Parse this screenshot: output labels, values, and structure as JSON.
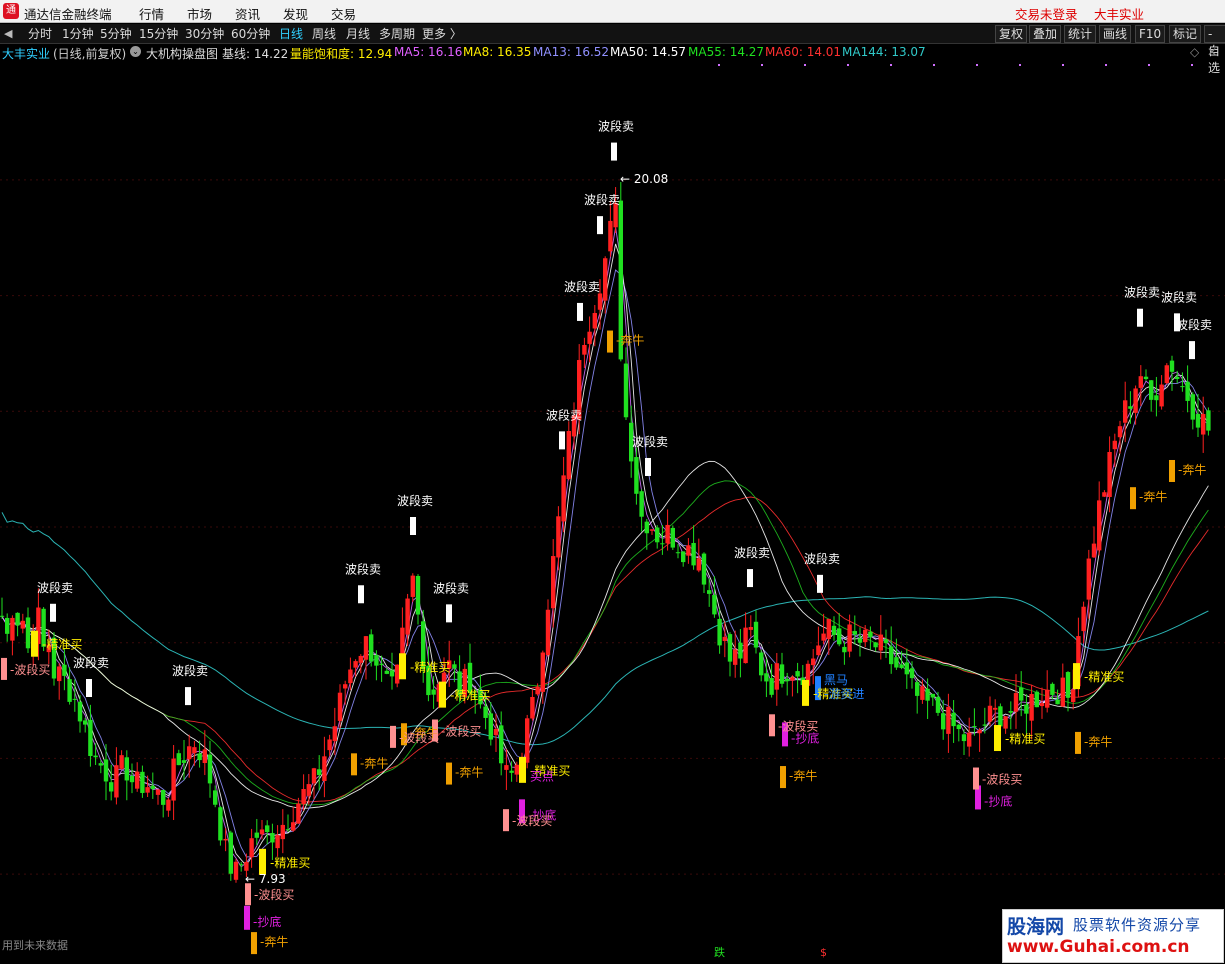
{
  "menubar": {
    "app_title": "通达信金融终端",
    "items": [
      "行情",
      "市场",
      "资讯",
      "发现",
      "交易"
    ],
    "login_status": "交易未登录",
    "stock_name": "大丰实业"
  },
  "toolbar": {
    "periods": [
      "分时",
      "1分钟",
      "5分钟",
      "15分钟",
      "30分钟",
      "60分钟",
      "日线",
      "周线",
      "月线",
      "多周期",
      "更多 〉"
    ],
    "active_period": "日线",
    "buttons": [
      "复权",
      "叠加",
      "统计",
      "画线",
      "F10",
      "标记",
      "-自选"
    ]
  },
  "infobar": {
    "stock": "大丰实业",
    "mode": "(日线,前复权)",
    "indicator_icon": "chevron-circle-icon",
    "indicator_name": "大机构操盘图",
    "baseline": "基线: 14.22",
    "energy": "量能饱和度: 12.94",
    "ma5": "MA5: 16.16",
    "ma8": "MA8: 16.35",
    "ma13": "MA13: 16.52",
    "ma50": "MA50: 14.57",
    "ma55": "MA55: 14.27",
    "ma60": "MA60: 14.01",
    "ma144": "MA144: 13.07"
  },
  "colors": {
    "up": "#ff2020",
    "down": "#20e020",
    "ma5": "#d070ff",
    "ma8": "#ffffff",
    "ma13": "#9090ff",
    "ma50": "#ffffff",
    "ma55": "#20c020",
    "ma60": "#ff3030",
    "ma144": "#30c8c8",
    "sell_box": "#ffffff",
    "buy_yellow": "#ffee00",
    "bull_orange": "#f0a000",
    "dip_magenta": "#e020e0",
    "wave_buy_pink": "#ff9090",
    "dark_horse_blue": "#2080ff"
  },
  "chart_data": {
    "type": "candlestick",
    "title": "大机构操盘图",
    "ylim": [
      7,
      21
    ],
    "high_label": "20.08",
    "low_label": "7.93",
    "signal_labels": {
      "wave_sell": "波段卖",
      "wave_buy": "波段买",
      "precise_buy": "精准买",
      "bull": "奔牛",
      "dip": "抄底",
      "buy_point": "买点",
      "dark_horse": "黑马",
      "capital_in": "游资进"
    },
    "bottom_markers": [
      "跌",
      "$"
    ],
    "keypoints": [
      [
        0,
        12.6
      ],
      [
        7,
        12.1
      ],
      [
        14,
        12.8
      ],
      [
        20,
        12.2
      ],
      [
        24,
        12.5
      ],
      [
        30,
        11.6
      ],
      [
        36,
        12.8
      ],
      [
        42,
        11.8
      ],
      [
        48,
        12.1
      ],
      [
        54,
        11.5
      ],
      [
        62,
        11.4
      ],
      [
        70,
        11.2
      ],
      [
        78,
        10.9
      ],
      [
        85,
        10.5
      ],
      [
        95,
        10.0
      ],
      [
        105,
        9.8
      ],
      [
        115,
        9.6
      ],
      [
        125,
        9.9
      ],
      [
        135,
        9.5
      ],
      [
        145,
        9.6
      ],
      [
        155,
        9.4
      ],
      [
        165,
        9.3
      ],
      [
        175,
        9.8
      ],
      [
        185,
        10.1
      ],
      [
        195,
        10.3
      ],
      [
        205,
        10.0
      ],
      [
        215,
        9.3
      ],
      [
        225,
        8.4
      ],
      [
        235,
        7.97
      ],
      [
        245,
        8.3
      ],
      [
        255,
        8.7
      ],
      [
        265,
        8.6
      ],
      [
        275,
        8.8
      ],
      [
        285,
        8.9
      ],
      [
        295,
        9.2
      ],
      [
        305,
        9.4
      ],
      [
        315,
        9.6
      ],
      [
        325,
        10.1
      ],
      [
        335,
        10.6
      ],
      [
        345,
        11.3
      ],
      [
        355,
        11.8
      ],
      [
        365,
        12.0
      ],
      [
        375,
        11.8
      ],
      [
        385,
        11.3
      ],
      [
        395,
        11.1
      ],
      [
        405,
        12.4
      ],
      [
        413,
        13.1
      ],
      [
        420,
        12.2
      ],
      [
        430,
        11.0
      ],
      [
        440,
        11.5
      ],
      [
        450,
        11.6
      ],
      [
        460,
        11.2
      ],
      [
        470,
        11.4
      ],
      [
        480,
        10.9
      ],
      [
        490,
        10.6
      ],
      [
        500,
        10.0
      ],
      [
        508,
        9.6
      ],
      [
        515,
        9.8
      ],
      [
        525,
        10.4
      ],
      [
        535,
        11.0
      ],
      [
        545,
        12.4
      ],
      [
        555,
        13.6
      ],
      [
        565,
        15.0
      ],
      [
        575,
        16.2
      ],
      [
        585,
        17.4
      ],
      [
        593,
        17.8
      ],
      [
        600,
        18.3
      ],
      [
        608,
        18.8
      ],
      [
        615,
        19.7
      ],
      [
        620,
        17.3
      ],
      [
        625,
        16.0
      ],
      [
        632,
        15.3
      ],
      [
        640,
        14.2
      ],
      [
        650,
        14.1
      ],
      [
        660,
        13.8
      ],
      [
        670,
        13.9
      ],
      [
        680,
        13.7
      ],
      [
        690,
        13.6
      ],
      [
        700,
        13.5
      ],
      [
        710,
        12.8
      ],
      [
        720,
        12.2
      ],
      [
        730,
        11.7
      ],
      [
        740,
        11.8
      ],
      [
        750,
        12.2
      ],
      [
        760,
        11.6
      ],
      [
        770,
        11.3
      ],
      [
        780,
        11.5
      ],
      [
        790,
        11.6
      ],
      [
        800,
        11.5
      ],
      [
        810,
        11.6
      ],
      [
        820,
        12.1
      ],
      [
        830,
        12.2
      ],
      [
        840,
        12.0
      ],
      [
        850,
        12.1
      ],
      [
        860,
        12.0
      ],
      [
        870,
        12.0
      ],
      [
        880,
        11.9
      ],
      [
        890,
        11.7
      ],
      [
        900,
        11.5
      ],
      [
        910,
        11.2
      ],
      [
        920,
        11.0
      ],
      [
        930,
        10.9
      ],
      [
        940,
        10.8
      ],
      [
        950,
        10.6
      ],
      [
        960,
        10.4
      ],
      [
        970,
        10.3
      ],
      [
        980,
        10.5
      ],
      [
        990,
        10.7
      ],
      [
        1000,
        10.8
      ],
      [
        1010,
        10.8
      ],
      [
        1020,
        10.9
      ],
      [
        1030,
        11.0
      ],
      [
        1040,
        11.1
      ],
      [
        1050,
        11.2
      ],
      [
        1060,
        11.2
      ],
      [
        1070,
        11.0
      ],
      [
        1080,
        12.4
      ],
      [
        1090,
        13.5
      ],
      [
        1100,
        14.4
      ],
      [
        1110,
        15.1
      ],
      [
        1120,
        15.8
      ],
      [
        1130,
        16.2
      ],
      [
        1140,
        16.7
      ],
      [
        1150,
        16.1
      ],
      [
        1160,
        16.6
      ],
      [
        1170,
        16.9
      ],
      [
        1180,
        16.5
      ],
      [
        1190,
        16.2
      ],
      [
        1200,
        15.9
      ],
      [
        1212,
        15.6
      ]
    ],
    "sell_signals": [
      53,
      89,
      188,
      361,
      413,
      449,
      562,
      580,
      600,
      614,
      648,
      750,
      820,
      1140,
      1177,
      1192
    ],
    "precise_buy_signals": [
      34,
      262,
      402,
      442,
      522,
      805,
      997,
      1076
    ],
    "bull_signals": [
      254,
      354,
      404,
      449,
      610,
      783,
      1078,
      1133,
      1172
    ]
  }
}
